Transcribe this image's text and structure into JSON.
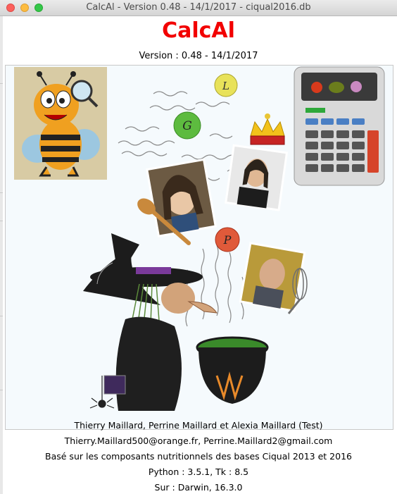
{
  "window": {
    "title": "CalcAl - Version 0.48 - 14/1/2017 - ciqual2016.db"
  },
  "header": {
    "app_name": "CalcAl",
    "version_line": "Version : 0.48 - 14/1/2017",
    "app_name_color": "#f20000"
  },
  "illustration": {
    "ball_letters": [
      "L",
      "G",
      "P"
    ],
    "icons": [
      "bee-mascot-icon",
      "calculator-icon",
      "witch-cauldron-icon",
      "crown-icon",
      "wooden-spoon-icon",
      "whisk-icon",
      "spider-icon"
    ]
  },
  "info": {
    "authors": "Thierry Maillard, Perrine Maillard et Alexia Maillard (Test)",
    "emails": "Thierry.Maillard500@orange.fr, Perrine.Maillard2@gmail.com",
    "based_on": "Basé sur les composants nutritionnels des bases Ciqual 2013 et 2016",
    "versions": "Python : 3.5.1, Tk : 8.5",
    "platform": "Sur : Darwin, 16.3.0"
  }
}
